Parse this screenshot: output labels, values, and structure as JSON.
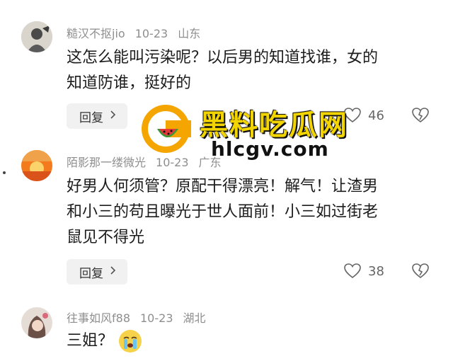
{
  "comments": [
    {
      "username": "糙汉不抠jio",
      "date": "10-23",
      "location": "山东",
      "text_lines": [
        "这怎么能叫污染呢？以后男的知道找谁，女的",
        "知道防谁，挺好的"
      ],
      "reply_label": "回复",
      "likes": "46"
    },
    {
      "username": "陌影那一缕微光",
      "date": "10-23",
      "location": "广东",
      "text_lines": [
        "好男人何须管？原配干得漂亮！解气！让渣男",
        "和小三的苟且曝光于世人面前！小三如过街老",
        "鼠见不得光"
      ],
      "reply_label": "回复",
      "likes": "38"
    },
    {
      "username": "往事如风f88",
      "date": "10-23",
      "location": "湖北",
      "text": "三姐？"
    }
  ],
  "watermark": {
    "title": "黑料吃瓜网",
    "url": "hlcgv.com"
  },
  "colors": {
    "meta_gray": "#8e8e8e",
    "watermark_yellow": "#f2d400",
    "logo_orange": "#f5a500"
  },
  "icons": [
    "chevron-right-icon",
    "heart-outline-icon",
    "broken-heart-icon",
    "crying-emoji-icon"
  ]
}
